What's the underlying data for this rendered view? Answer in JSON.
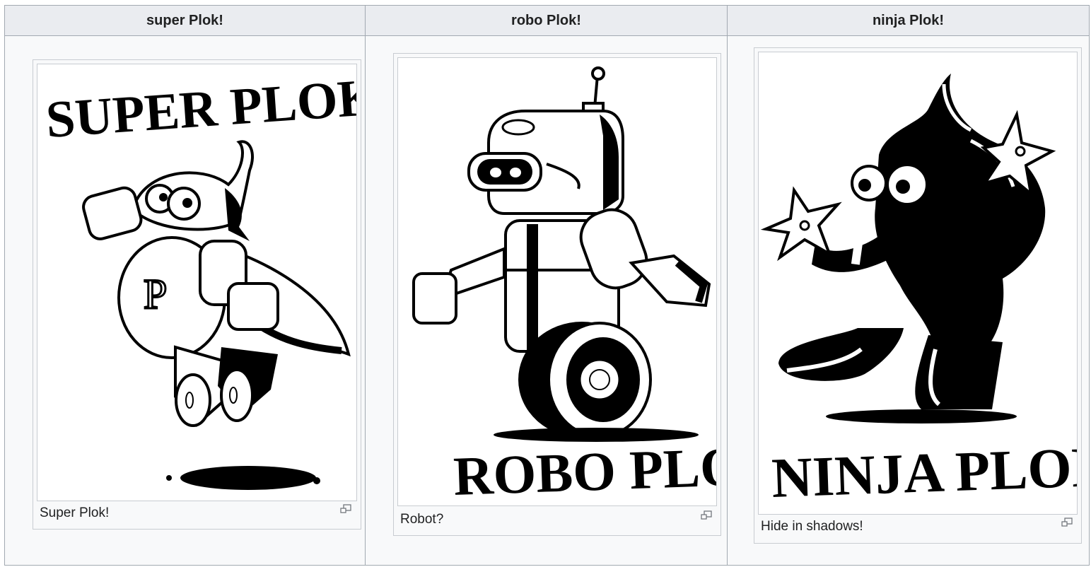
{
  "columns": [
    {
      "header": "super Plok!",
      "caption": "Super Plok!",
      "title_text": "SUPER PLOK"
    },
    {
      "header": "robo Plok!",
      "caption": "Robot?",
      "title_text": "ROBO PLOK"
    },
    {
      "header": "ninja Plok!",
      "caption": "Hide in shadows!",
      "title_text": "NINJA PLOK"
    }
  ]
}
